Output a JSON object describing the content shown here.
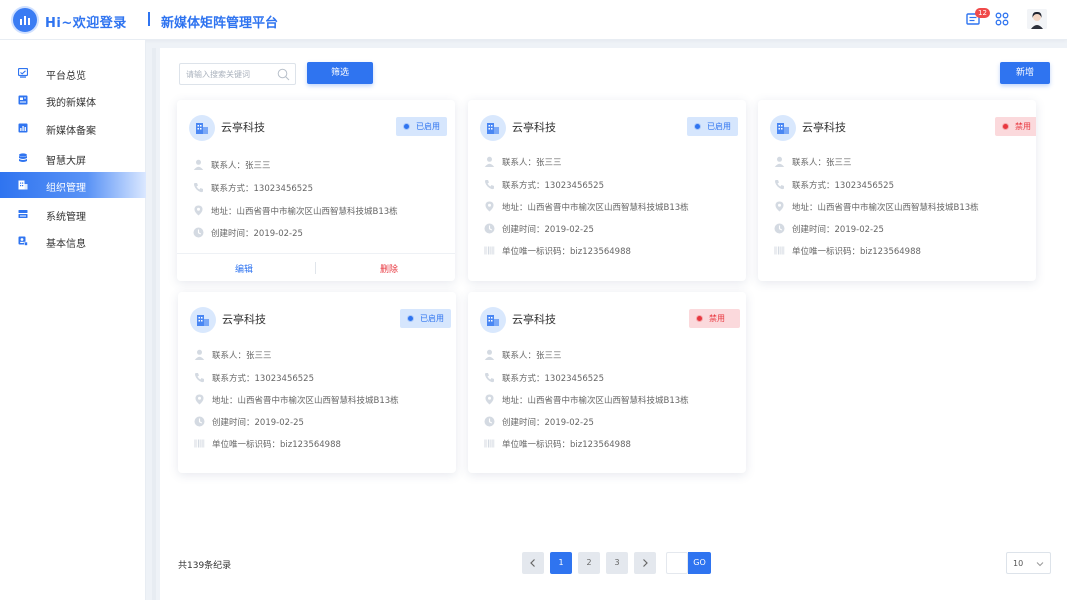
{
  "header": {
    "greeting": "Hi~欢迎登录",
    "app_title": "新媒体矩阵管理平台",
    "message_count": "12"
  },
  "sidebar": {
    "items": [
      {
        "label": "平台总览",
        "icon": "dashboard-icon"
      },
      {
        "label": "我的新媒体",
        "icon": "media-icon"
      },
      {
        "label": "新媒体备案",
        "icon": "record-icon"
      },
      {
        "label": "智慧大屏",
        "icon": "screen-icon"
      },
      {
        "label": "组织管理",
        "icon": "organization-icon",
        "active": true
      },
      {
        "label": "系统管理",
        "icon": "system-icon"
      },
      {
        "label": "基本信息",
        "icon": "info-icon"
      }
    ]
  },
  "toolbar": {
    "search_placeholder": "请输入搜索关键词",
    "filter_label": "筛选",
    "add_label": "新增"
  },
  "cards": [
    {
      "name": "云亭科技",
      "status": "已启用",
      "contact": "联系人：张三三",
      "phone": "联系方式：13023456525",
      "address": "地址：山西省晋中市榆次区山西智慧科技城B13栋",
      "created": "创建时间：2019-02-25",
      "actions": {
        "edit": "编辑",
        "delete": "删除"
      }
    },
    {
      "name": "云亭科技",
      "status": "已启用",
      "contact": "联系人：张三三",
      "phone": "联系方式：13023456525",
      "address": "地址：山西省晋中市榆次区山西智慧科技城B13栋",
      "created": "创建时间：2019-02-25",
      "code": "单位唯一标识码：biz123564988"
    },
    {
      "name": "云亭科技",
      "status": "禁用",
      "contact": "联系人：张三三",
      "phone": "联系方式：13023456525",
      "address": "地址：山西省晋中市榆次区山西智慧科技城B13栋",
      "created": "创建时间：2019-02-25",
      "code": "单位唯一标识码：biz123564988"
    },
    {
      "name": "云亭科技",
      "status": "已启用",
      "contact": "联系人：张三三",
      "phone": "联系方式：13023456525",
      "address": "地址：山西省晋中市榆次区山西智慧科技城B13栋",
      "created": "创建时间：2019-02-25",
      "code": "单位唯一标识码：biz123564988"
    },
    {
      "name": "云亭科技",
      "status": "禁用",
      "contact": "联系人：张三三",
      "phone": "联系方式：13023456525",
      "address": "地址：山西省晋中市榆次区山西智慧科技城B13栋",
      "created": "创建时间：2019-02-25",
      "code": "单位唯一标识码：biz123564988"
    }
  ],
  "pagination": {
    "total": "共139条纪录",
    "pages": [
      "1",
      "2",
      "3"
    ],
    "current": "1",
    "go_label": "GO",
    "page_size": "10"
  },
  "colors": {
    "primary": "#2f74f0",
    "enabled": "#2f74f0",
    "disabled": "#e8373f"
  }
}
